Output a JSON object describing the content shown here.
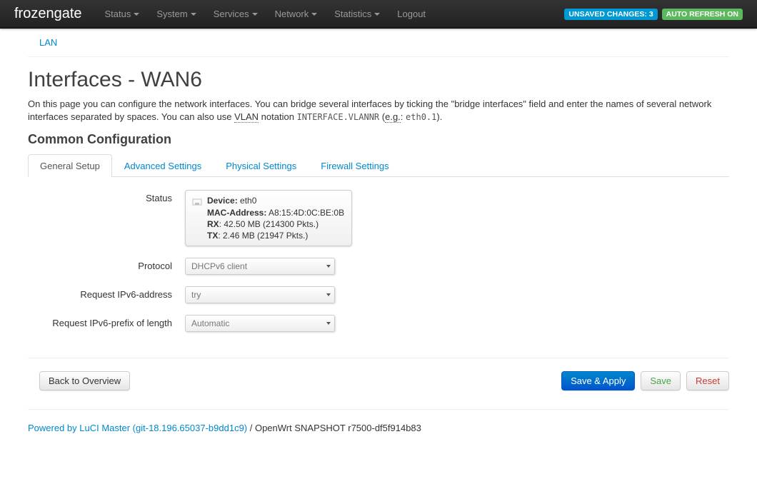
{
  "brand": "frozengate",
  "nav": {
    "status": "Status",
    "system": "System",
    "services": "Services",
    "network": "Network",
    "statistics": "Statistics",
    "logout": "Logout"
  },
  "badges": {
    "unsaved": "UNSAVED CHANGES: 3",
    "autorefresh": "AUTO REFRESH ON"
  },
  "breadcrumb": {
    "lan": "LAN"
  },
  "page": {
    "title": "Interfaces - WAN6",
    "desc_pre": "On this page you can configure the network interfaces. You can bridge several interfaces by ticking the \"bridge interfaces\" field and enter the names of several network interfaces separated by spaces. You can also use ",
    "desc_vlan": "VLAN",
    "desc_mid": " notation ",
    "desc_code1": "INTERFACE.VLANNR",
    "desc_open": " (",
    "desc_eg": "e.g.",
    "desc_colon": ": ",
    "desc_code2": "eth0.1",
    "desc_close": ")."
  },
  "section_title": "Common Configuration",
  "tabs": {
    "general": "General Setup",
    "advanced": "Advanced Settings",
    "physical": "Physical Settings",
    "firewall": "Firewall Settings"
  },
  "labels": {
    "status": "Status",
    "protocol": "Protocol",
    "req_ipv6_addr": "Request IPv6-address",
    "req_ipv6_prefix": "Request IPv6-prefix of length"
  },
  "status": {
    "device_k": "Device:",
    "device_v": " eth0",
    "mac_k": "MAC-Address:",
    "mac_v": " A8:15:4D:0C:BE:0B",
    "rx_k": "RX",
    "rx_v": ": 42.50 MB (214300 Pkts.)",
    "tx_k": "TX",
    "tx_v": ": 2.46 MB (21947 Pkts.)"
  },
  "selects": {
    "protocol": "DHCPv6 client",
    "ipv6addr": "try",
    "ipv6prefix": "Automatic"
  },
  "buttons": {
    "back": "Back to Overview",
    "saveapply": "Save & Apply",
    "save": "Save",
    "reset": "Reset"
  },
  "footer": {
    "link": "Powered by LuCI Master (git-18.196.65037-b9dd1c9)",
    "rest": " / OpenWrt SNAPSHOT r7500-df5f914b83"
  }
}
